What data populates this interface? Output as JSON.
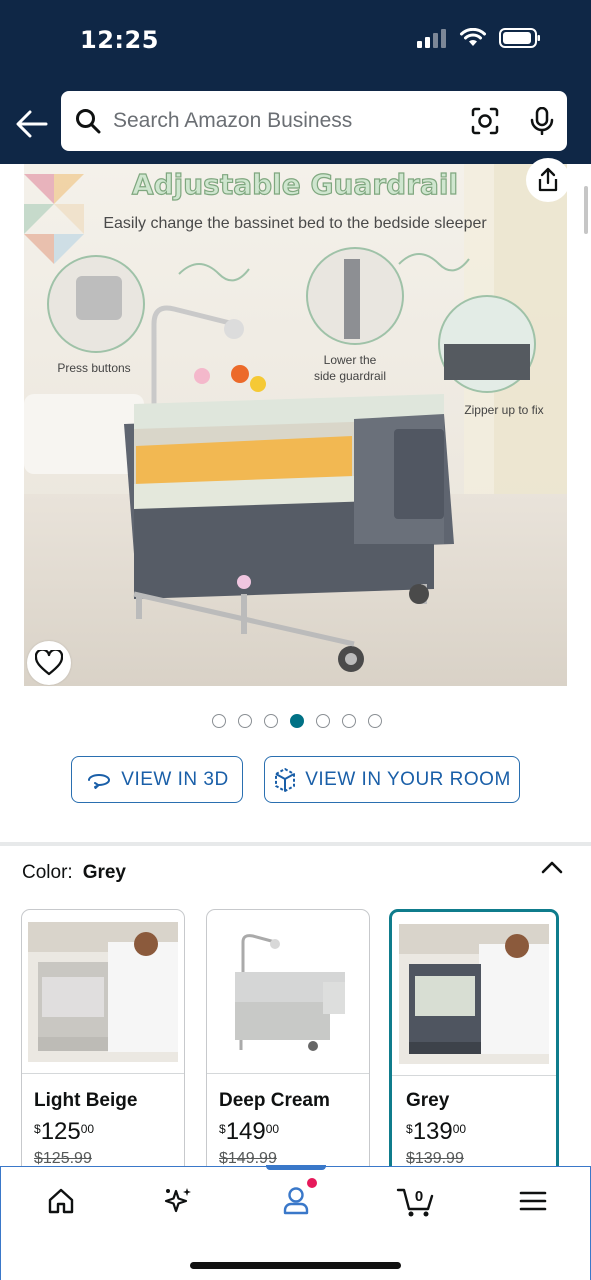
{
  "status": {
    "time": "12:25"
  },
  "search": {
    "placeholder": "Search Amazon Business"
  },
  "product_image": {
    "headline": "Adjustable Guardrail",
    "subheadline": "Easily change the bassinet bed to the bedside sleeper",
    "callouts": [
      "Press buttons",
      "Lower the side guardrail",
      "Zipper up to fix"
    ],
    "alt": "bassinet bedside sleeper"
  },
  "carousel": {
    "total": 7,
    "active_index": 3
  },
  "actions": {
    "view_3d": "VIEW IN 3D",
    "view_room": "VIEW IN YOUR ROOM"
  },
  "color": {
    "label": "Color:",
    "selected": "Grey"
  },
  "swatches": [
    {
      "name": "Light Beige",
      "currency": "$",
      "whole": "125",
      "fraction": "00",
      "list_price": "$125.99",
      "selected": false
    },
    {
      "name": "Deep Cream",
      "currency": "$",
      "whole": "149",
      "fraction": "00",
      "list_price": "$149.99",
      "selected": false
    },
    {
      "name": "Grey",
      "currency": "$",
      "whole": "139",
      "fraction": "00",
      "list_price": "$139.99",
      "selected": true
    }
  ],
  "tabbar": {
    "cart_count": "0",
    "active_tab": "account"
  },
  "colors": {
    "header_bg": "#0f2746",
    "accent_teal": "#007185",
    "link_blue": "#1a5fa8",
    "notif": "#e6195a"
  }
}
